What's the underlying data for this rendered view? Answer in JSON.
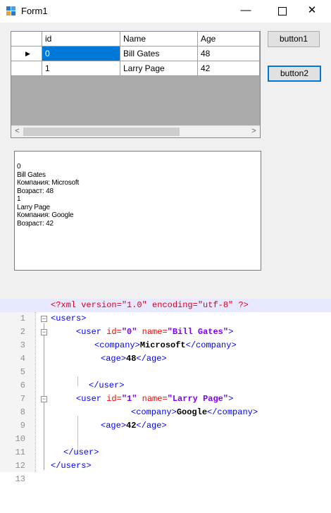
{
  "window": {
    "title": "Form1",
    "controls": {
      "minimize": "—",
      "close": "✕"
    }
  },
  "grid": {
    "columns": [
      "id",
      "Name",
      "Age"
    ],
    "rows": [
      {
        "id": "0",
        "name": "Bill Gates",
        "age": "48",
        "current": true
      },
      {
        "id": "1",
        "name": "Larry Page",
        "age": "42",
        "current": false
      }
    ],
    "row_indicator": "▶",
    "scroll_left": "<",
    "scroll_right": ">"
  },
  "buttons": {
    "button1": "button1",
    "button2": "button2"
  },
  "output": {
    "lines": [
      "0",
      "Bill Gates",
      "Компания: Microsoft",
      "Возраст: 48",
      "1",
      "Larry Page",
      "Компания: Google",
      "Возраст: 42"
    ]
  },
  "editor": {
    "line_numbers": [
      "1",
      "2",
      "3",
      "4",
      "5",
      "6",
      "7",
      "8",
      "9",
      "10",
      "11",
      "12",
      "13"
    ],
    "lines": [
      "<?xml version=\"1.0\" encoding=\"utf-8\" ?>",
      "<users>",
      "<user id=\"0\" name=\"Bill Gates\">",
      "<company>Microsoft</company>",
      "<age>48</age>",
      "",
      "</user>",
      "<user id=\"1\" name=\"Larry Page\">",
      "<company>Google</company>",
      "<age>42</age>",
      "",
      "</user>",
      "</users>"
    ]
  },
  "colors": {
    "selection": "#0078d7",
    "xml_tag": "#0000ff",
    "xml_attr": "#ff0000",
    "xml_value": "#8000ff",
    "xml_decl": "#e0001a"
  }
}
